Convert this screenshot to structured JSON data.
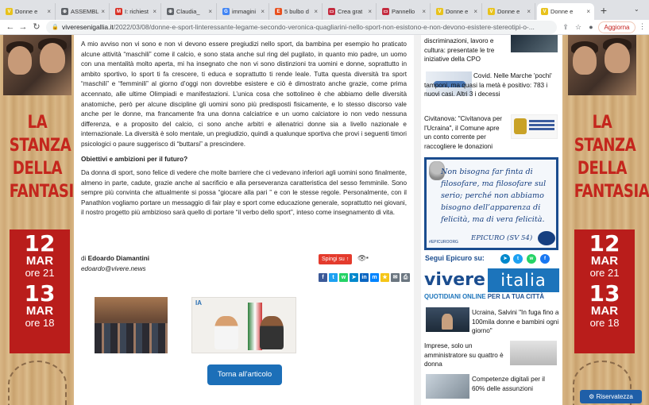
{
  "browser": {
    "tabs": [
      {
        "title": "Donne e",
        "fav": "V",
        "color": "#e8c21c",
        "active": false
      },
      {
        "title": "ASSEMBL",
        "fav": "⊕",
        "color": "#5f6368",
        "active": false
      },
      {
        "title": "I: richiest",
        "fav": "M",
        "color": "#d93025",
        "active": false
      },
      {
        "title": "Claudia_",
        "fav": "⊕",
        "color": "#5f6368",
        "active": false
      },
      {
        "title": "immagini",
        "fav": "G",
        "color": "#4285f4",
        "active": false
      },
      {
        "title": "5 bulbo d",
        "fav": "E",
        "color": "#e8501e",
        "active": false
      },
      {
        "title": "Crea grat",
        "fav": "▭",
        "color": "#c42b3f",
        "active": false
      },
      {
        "title": "Pannello",
        "fav": "▭",
        "color": "#c42b3f",
        "active": false
      },
      {
        "title": "Donne e",
        "fav": "V",
        "color": "#e8c21c",
        "active": false
      },
      {
        "title": "Donne e",
        "fav": "V",
        "color": "#e8c21c",
        "active": false
      },
      {
        "title": "Donne e",
        "fav": "V",
        "color": "#e8c21c",
        "active": true
      }
    ],
    "new_tab": "+",
    "url_domain": "viveresenigallia.it",
    "url_path": "/2022/03/08/donne-e-sport-linteressante-legame-secondo-veronica-quagliarini-nello-sport-non-esistono-e-non-devono-esistere-stereotipi-o-...",
    "update_label": "Aggiorna"
  },
  "poster": {
    "title_lines": [
      "LA",
      "STANZA",
      "DELLA",
      "FANTASIA"
    ],
    "date1_day": "12",
    "date1_month": "MAR",
    "date1_time": "ore 21",
    "date2_day": "13",
    "date2_month": "MAR",
    "date2_time": "ore 18"
  },
  "article": {
    "para1": "A mio avviso non vi sono e non vi devono essere pregiudizi nello sport, da bambina per esempio ho praticato alcune attività “maschili” come il calcio, e sono stata anche sul ring del pugilato, in quanto mio padre, un uomo con una mentalità molto aperta, mi ha insegnato che non vi sono distinzioni tra uomini e donne, soprattutto in ambito sportivo, lo sport ti fa crescere, ti educa e soprattutto ti rende leale. Tutta questa diversità tra sport “maschili” e “femminili” al giorno d’oggi non dovrebbe esistere e ciò è dimostrato anche grazie, come prima accennato, alle ultime Olimpiadi e manifestazioni. L’unica cosa che sottolineo è che abbiamo delle diversità anatomiche, però per alcune discipline gli uomini sono più predisposti fisicamente, e lo stesso discorso vale anche per le donne, ma francamente fra una donna calciatrice e un uomo calciatore io non vedo nessuna differenza, e a proposito del calcio, ci sono anche arbitri e allenatrici donne sia a livello nazionale e internazionale. La diversità è solo mentale, un pregiudizio, quindi a qualunque sportiva che provi i seguenti timori psicologici o paure suggerisco di “buttarsi” a prescindere.",
    "subheading": "Obiettivi e ambizioni per il futuro?",
    "para2": "Da donna di sport, sono felice di vedere che molte barriere che ci vedevano inferiori agli uomini sono finalmente, almeno in parte, cadute, grazie anche al sacrificio e alla perseveranza caratteristica del sesso femminile. Sono sempre più convinta che attualmente si possa “giocare alla pari ” e con le stesse regole. Personalmente, con il Panathlon vogliamo portare un messaggio di fair play e sport come educazione generale, soprattutto nei giovani, il nostro progetto più ambizioso sarà quello di portare “il verbo dello sport”, inteso come insegnamento di vita.",
    "author_prefix": "di ",
    "author_name": "Edoardo Diamantini",
    "author_email": "edoardo@vivere.news",
    "push_label": "Spingi su",
    "photo_tag": "IA",
    "back_label": "Torna all'articolo"
  },
  "sidebar": {
    "news": [
      {
        "text": "discriminazioni, lavoro e cultura: presentate le tre iniziative della CPO"
      },
      {
        "text": "Covid. Nelle Marche 'pochi' tamponi, ma quasi la metà è positivo: 783 i nuovi casi. Altri 3 i decessi"
      },
      {
        "text": "Civitanova: \"Civitanova per l'Ucraina\", il Comune apre un conto corrente per raccogliere le donazioni"
      },
      {
        "text": "Ucraina, Salvini \"In fuga fino a 100mila donne e bambini ogni giorno\""
      },
      {
        "text": "Imprese, solo un amministratore su quattro è donna"
      },
      {
        "text": "Competenze digitali per il 60% delle assunzioni"
      }
    ],
    "epicuro_quote": "Non bisogna far finta di filosofare, ma filosofare sul serio; perché non abbiamo bisogno dell’apparenza di felicità, ma di vera felicità.",
    "epicuro_sig": "EPICURO (SV 54)",
    "epicuro_tag": "#EPICUROORG",
    "segui_label": "Segui Epicuro su:",
    "vivere": "vivere",
    "italia": "italia",
    "tagline_a": "QUOTIDIANI ONLINE",
    "tagline_b": " PER LA TUA CITTÀ"
  },
  "privacy_label": "Riservatezza"
}
